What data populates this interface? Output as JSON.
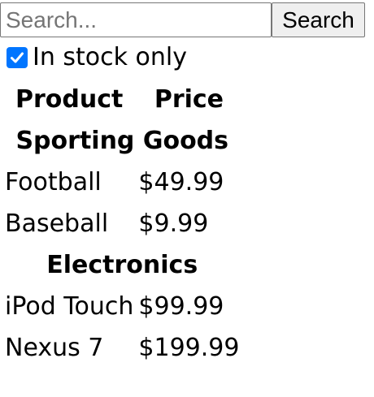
{
  "search": {
    "placeholder": "Search...",
    "value": "",
    "button_label": "Search"
  },
  "filter": {
    "in_stock_only_label": "In stock only",
    "in_stock_only_checked": true
  },
  "table": {
    "headers": {
      "name": "Product",
      "price": "Price"
    },
    "categories": [
      {
        "name": "Sporting Goods",
        "rows": [
          {
            "name": "Football",
            "price": "$49.99"
          },
          {
            "name": "Baseball",
            "price": "$9.99"
          }
        ]
      },
      {
        "name": "Electronics",
        "rows": [
          {
            "name": "iPod Touch",
            "price": "$99.99"
          },
          {
            "name": "Nexus 7",
            "price": "$199.99"
          }
        ]
      }
    ]
  },
  "colors": {
    "checkbox_accent": "#0075ff",
    "button_bg": "#efefef",
    "border": "#767676"
  }
}
